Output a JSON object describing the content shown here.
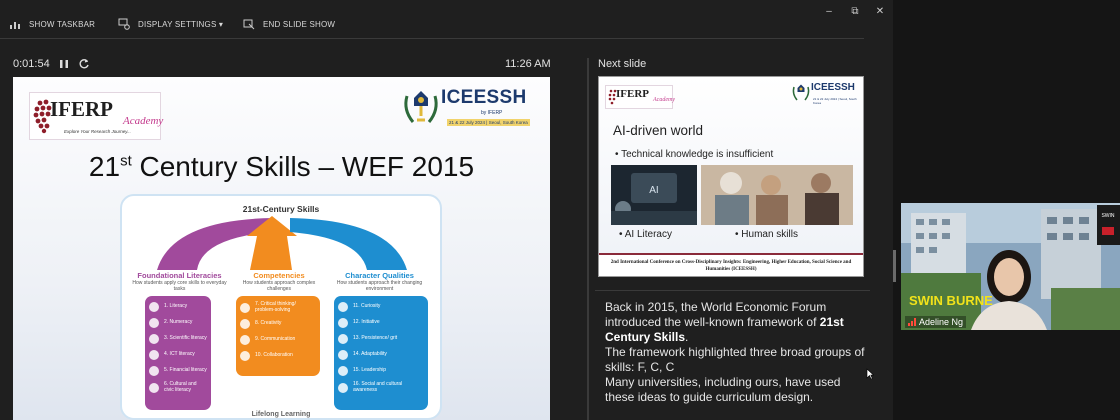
{
  "toolbar": {
    "show_taskbar": "SHOW TASKBAR",
    "display_settings": "DISPLAY SETTINGS ▾",
    "end_slide_show": "END SLIDE SHOW",
    "minimize": "–",
    "restore": "⧉",
    "close": "✕"
  },
  "timer": {
    "elapsed": "0:01:54",
    "clock": "11:26 AM"
  },
  "current_slide": {
    "iferp_word": "IFERP",
    "iferp_academy": "Academy",
    "iferp_tagline": "Explore Your Research Journey...",
    "iceessh_name": "ICEESSH",
    "iceessh_by": "by IFERP",
    "iceessh_date": "21 & 22 July 2024 | Seoul, South Korea",
    "title_main": "21",
    "title_sup": "st",
    "title_rest": " Century Skills – WEF 2015",
    "diagram": {
      "title": "21st-Century Skills",
      "columns": [
        {
          "head": "Foundational Literacies",
          "sub": "How students apply core skills to everyday tasks",
          "items": [
            "1. Literacy",
            "2. Numeracy",
            "3. Scientific literacy",
            "4. ICT literacy",
            "5. Financial literacy",
            "6. Cultural and civic literacy"
          ]
        },
        {
          "head": "Competencies",
          "sub": "How students approach complex challenges",
          "items": [
            "7. Critical thinking/ problem-solving",
            "8. Creativity",
            "9. Communication",
            "10. Collaboration"
          ]
        },
        {
          "head": "Character Qualities",
          "sub": "How students approach their changing environment",
          "items": [
            "11. Curiosity",
            "12. Initiative",
            "13. Persistence/ grit",
            "14. Adaptability",
            "15. Leadership",
            "16. Social and cultural awareness"
          ]
        }
      ],
      "footer": "Lifelong Learning"
    }
  },
  "next_slide": {
    "label": "Next slide",
    "iferp_word": "IFERP",
    "iferp_academy": "Academy",
    "iceessh_name": "ICEESSH",
    "iceessh_date": "21 & 22 July 2024 | Seoul, South Korea",
    "title": "AI-driven world",
    "bullet_main": "•  Technical knowledge is insufficient",
    "bullet_left": "•  AI Literacy",
    "bullet_right": "•  Human skills",
    "footer": "2nd International Conference on Cross-Disciplinary Insights: Engineering, Higher Education, Social Science and Humanities (ICEESSH)"
  },
  "notes": {
    "line1": "Back in 2015, the World Economic Forum introduced the well-known framework of",
    "bold": "21st Century Skills",
    "line2": ".",
    "line3": "The framework highlighted three broad groups of skills: F, C, C",
    "line4": "Many universities, including ours, have used these ideas to guide curriculum design."
  },
  "webcam": {
    "participant": "Adeline Ng",
    "banner": "SWIN BURNE"
  },
  "colors": {
    "foundational": "#a14a9c",
    "competencies": "#f28c1f",
    "character": "#1e8ed0"
  }
}
